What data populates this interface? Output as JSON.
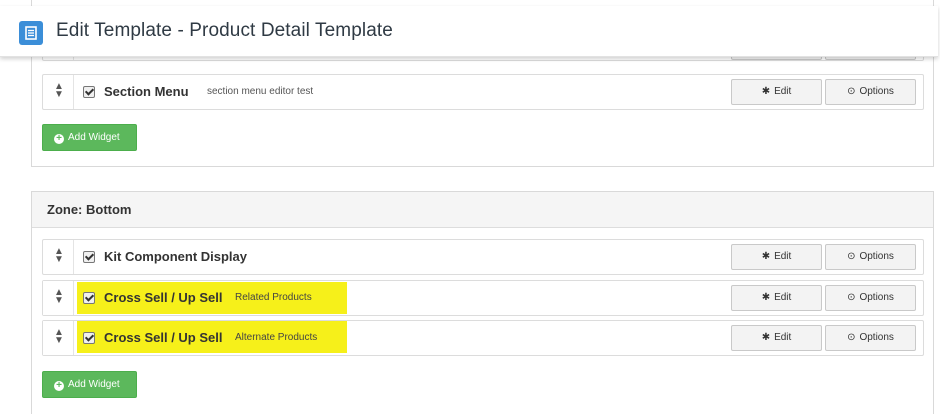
{
  "header": {
    "title": "Edit Template - Product Detail Template",
    "icon": "document-icon",
    "accent": "#3b8ed8"
  },
  "top_zone": {
    "widgets": [
      {
        "title": "Section Menu",
        "subtitle": "section menu editor test",
        "checked": true
      }
    ],
    "add_label": "Add Widget"
  },
  "bottom_zone": {
    "heading": "Zone: Bottom",
    "widgets": [
      {
        "title": "Kit Component Display",
        "subtitle": "",
        "checked": true
      },
      {
        "title": "Cross Sell / Up Sell",
        "subtitle": "Related Products",
        "checked": true,
        "highlighted": true
      },
      {
        "title": "Cross Sell / Up Sell",
        "subtitle": "Alternate Products",
        "checked": true,
        "highlighted": true
      }
    ],
    "add_label": "Add Widget"
  },
  "buttons": {
    "edit_label": "Edit",
    "options_label": "Options"
  },
  "colors": {
    "highlight": "#f6f01a",
    "add_button": "#5cb85c"
  }
}
